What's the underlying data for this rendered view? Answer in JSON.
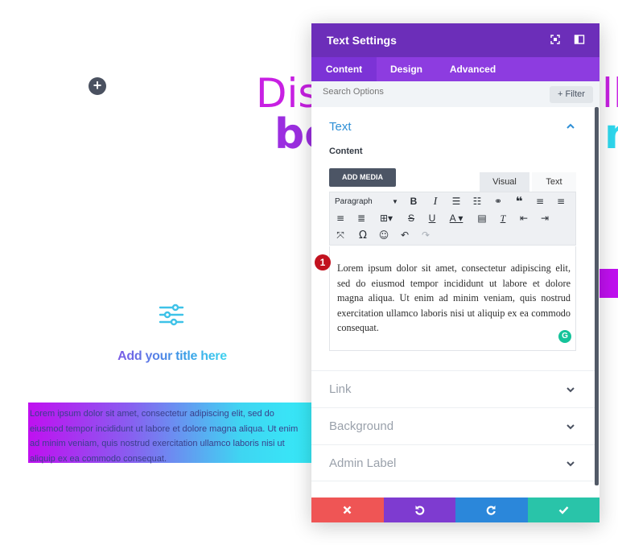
{
  "background": {
    "add_button": "+",
    "hero": {
      "line1_left": "Dis",
      "line1_right": "ll",
      "line2_left": "be",
      "line2_right": "nt"
    },
    "blurb": {
      "icon": "sliders-icon",
      "title": "Add your title here"
    },
    "gradient_text": "Lorem ipsum dolor sit amet, consectetur adipiscing elit, sed do eiusmod tempor incididunt ut labore et dolore magna aliqua. Ut enim ad minim veniam, quis nostrud exercitation ullamco laboris nisi ut aliquip ex ea commodo consequat."
  },
  "panel": {
    "title": "Text Settings",
    "header_icons": [
      "expand-icon",
      "sidebar-layout-icon"
    ],
    "tabs": [
      {
        "label": "Content",
        "active": true
      },
      {
        "label": "Design",
        "active": false
      },
      {
        "label": "Advanced",
        "active": false
      }
    ],
    "search": {
      "placeholder": "Search Options",
      "filter_label": "+ Filter"
    },
    "text_section": {
      "title": "Text",
      "content_label": "Content",
      "add_media_label": "ADD MEDIA",
      "editor_tabs": [
        "Visual",
        "Text"
      ],
      "paragraph_label": "Paragraph",
      "body": "Lorem ipsum dolor sit amet, consectetur adipiscing elit, sed do eiusmod tempor incididunt ut labore et dolore magna aliqua. Ut enim ad minim veniam, quis nostrud exercitation ullamco laboris nisi ut aliquip ex ea commodo consequat."
    },
    "marker_number": "1",
    "grammarly_letter": "G",
    "collapsed_sections": [
      {
        "label": "Link"
      },
      {
        "label": "Background"
      },
      {
        "label": "Admin Label"
      }
    ],
    "footer_buttons": [
      "discard",
      "undo",
      "redo",
      "save"
    ]
  },
  "colors": {
    "header": "#6c2eb9",
    "tabs": "#8d3ce0",
    "discard": "#ef5555",
    "undo": "#7e3bd0",
    "redo": "#2b87da",
    "save": "#29c4a9",
    "accent_blue": "#2e8fd6"
  }
}
